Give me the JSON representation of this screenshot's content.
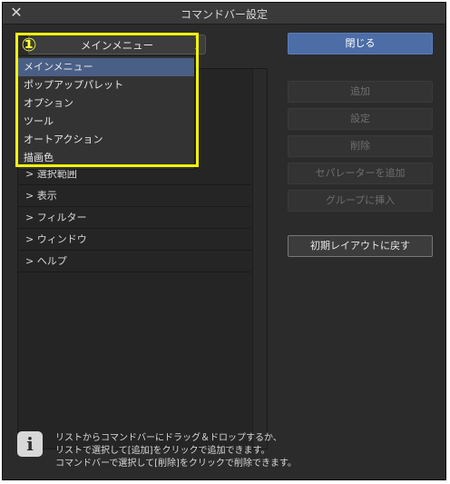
{
  "window": {
    "title": "コマンドバー設定",
    "close_symbol": "✕"
  },
  "selector": {
    "value": "メインメニュー",
    "arrows": "⌃⌄",
    "badge": "①"
  },
  "dropdown": {
    "options": [
      "メインメニュー",
      "ポップアップパレット",
      "オプション",
      "ツール",
      "オートアクション",
      "描画色"
    ]
  },
  "tree": {
    "items": [
      "> 選択範囲",
      "> 表示",
      "> フィルター",
      "> ウィンドウ",
      "> ヘルプ"
    ]
  },
  "buttons": {
    "close": "閉じる",
    "add": "追加",
    "settings": "設定",
    "delete": "削除",
    "add_separator": "セパレーターを追加",
    "insert_group": "グループに挿入",
    "reset_layout": "初期レイアウトに戻す"
  },
  "info": {
    "icon": "i",
    "lines": [
      "リストからコマンドバーにドラッグ＆ドロップするか、",
      "リストで選択して[追加]をクリックで追加できます。",
      "コマンドバーで選択して[削除]をクリックで削除できます。"
    ]
  },
  "colors": {
    "highlight": "#f2f20f",
    "primary_button": "#4d6da6",
    "selected_option": "#4a5f86"
  }
}
